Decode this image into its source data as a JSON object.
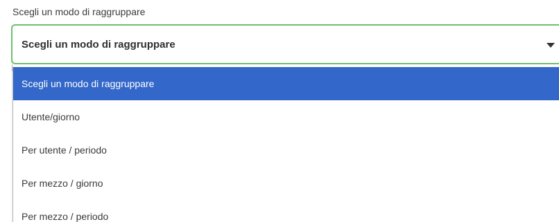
{
  "field": {
    "label": "Scegli un modo di raggruppare",
    "selected_value": "Scegli un modo di raggruppare"
  },
  "dropdown": {
    "options": [
      {
        "label": "Scegli un modo di raggruppare",
        "selected": true
      },
      {
        "label": "Utente/giorno",
        "selected": false
      },
      {
        "label": "Per utente / periodo",
        "selected": false
      },
      {
        "label": "Per mezzo / giorno",
        "selected": false
      },
      {
        "label": "Per mezzo / periodo",
        "selected": false
      }
    ]
  },
  "colors": {
    "focus_border": "#6cbf6c",
    "selected_background": "#3367c9",
    "selected_text": "#ffffff"
  },
  "icons": {
    "caret": "chevron-down-icon"
  }
}
